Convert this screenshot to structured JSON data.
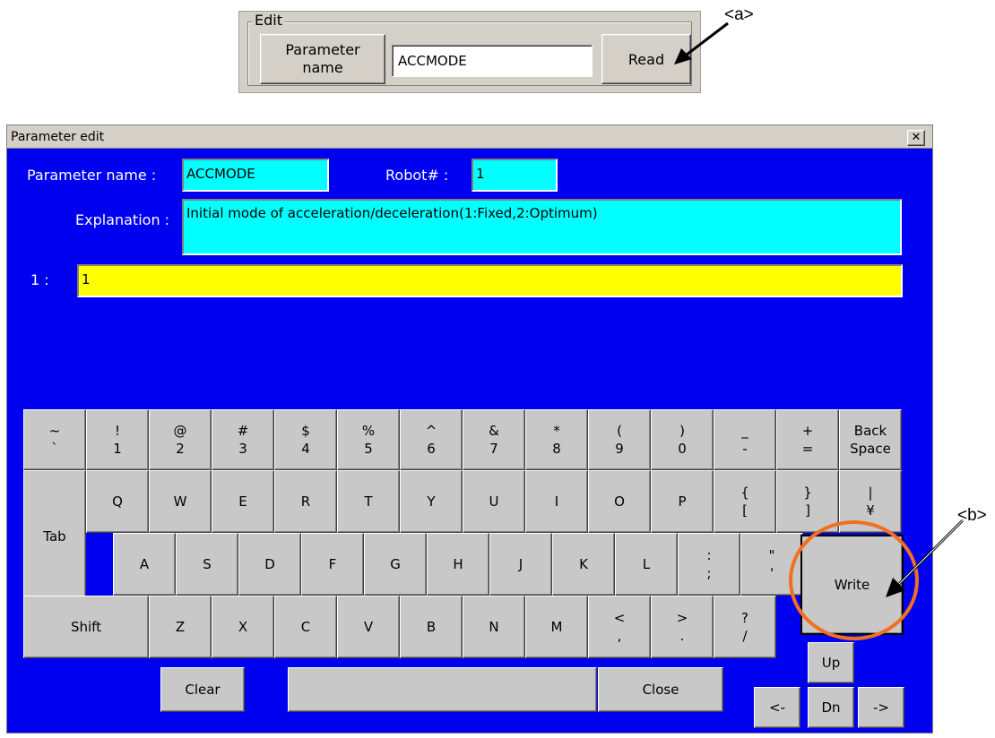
{
  "edit_group": {
    "legend": "Edit",
    "param_button": "Parameter\nname",
    "param_value": "ACCMODE",
    "read_button": "Read"
  },
  "callouts": {
    "a": "<a>",
    "b": "<b>"
  },
  "dialog": {
    "title": "Parameter edit",
    "close_glyph": "✕",
    "param_name_label": "Parameter name :",
    "param_name_value": "ACCMODE",
    "robot_label": "Robot# :",
    "robot_value": "1",
    "explanation_label": "Explanation :",
    "explanation_value": "Initial mode of acceleration/deceleration(1:Fixed,2:Optimum)",
    "value_label": "1 :",
    "value": "1"
  },
  "keyboard": {
    "row1": [
      [
        "~",
        "`"
      ],
      [
        "!",
        "1"
      ],
      [
        "@",
        "2"
      ],
      [
        "#",
        "3"
      ],
      [
        "$",
        "4"
      ],
      [
        "%",
        "5"
      ],
      [
        "^",
        "6"
      ],
      [
        "&",
        "7"
      ],
      [
        "*",
        "8"
      ],
      [
        "(",
        "9"
      ],
      [
        ")",
        "0"
      ],
      [
        "_",
        "-"
      ],
      [
        "+",
        "="
      ],
      [
        "Back",
        "Space"
      ]
    ],
    "tab": "Tab",
    "row2": [
      "Q",
      "W",
      "E",
      "R",
      "T",
      "Y",
      "U",
      "I",
      "O",
      "P"
    ],
    "row2_sym": [
      [
        "{",
        "["
      ],
      [
        "}",
        "]"
      ],
      [
        "|",
        "¥"
      ]
    ],
    "row3": [
      "A",
      "S",
      "D",
      "F",
      "G",
      "H",
      "J",
      "K",
      "L"
    ],
    "row3_sym": [
      [
        ":",
        ";"
      ],
      [
        "\"",
        "'"
      ]
    ],
    "shift": "Shift",
    "row4": [
      "Z",
      "X",
      "C",
      "V",
      "B",
      "N",
      "M"
    ],
    "row4_sym": [
      [
        "<",
        ","
      ],
      [
        ">",
        "."
      ],
      [
        "?",
        "/"
      ]
    ],
    "write": "Write",
    "clear": "Clear",
    "space": "",
    "close": "Close",
    "up": "Up",
    "down": "Dn",
    "left": "<-",
    "right": "->"
  },
  "colors": {
    "dialog_bg": "#0000f0",
    "field_cyan": "#00ffff",
    "field_yellow": "#ffff00",
    "callout_circle": "#f07020"
  }
}
